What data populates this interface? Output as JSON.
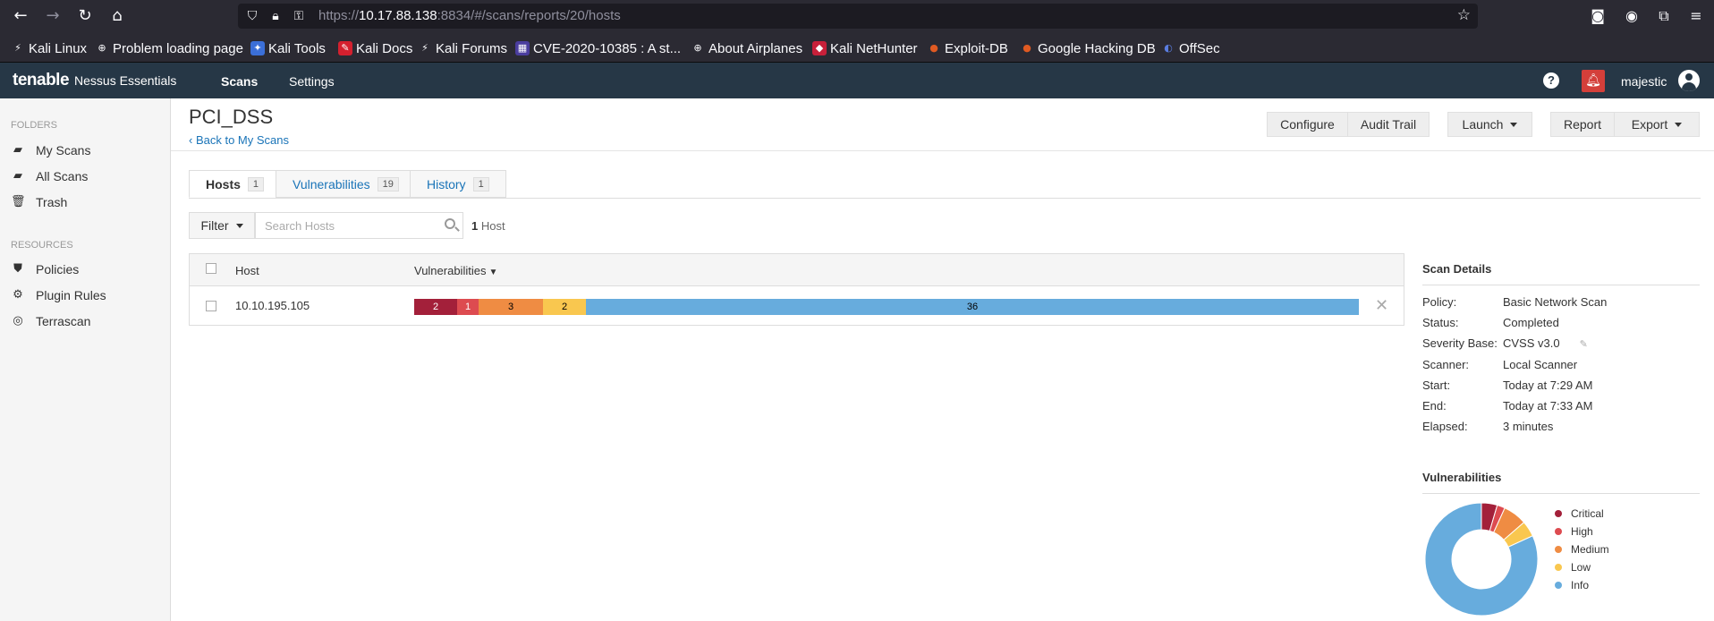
{
  "browser": {
    "url_prefix": "https://",
    "url_host": "10.17.88.138",
    "url_rest": ":8834/#/scans/reports/20/hosts",
    "bookmarks": [
      {
        "label": "Kali Linux",
        "icon": "kali-dragon-icon"
      },
      {
        "label": "Problem loading page",
        "icon": "globe-icon"
      },
      {
        "label": "Kali Tools",
        "icon": "kali-tools-icon"
      },
      {
        "label": "Kali Docs",
        "icon": "kali-docs-icon"
      },
      {
        "label": "Kali Forums",
        "icon": "kali-forums-icon"
      },
      {
        "label": "CVE-2020-10385 : A st...",
        "icon": "cve-icon"
      },
      {
        "label": "About Airplanes",
        "icon": "globe-icon"
      },
      {
        "label": "Kali NetHunter",
        "icon": "nethunter-icon"
      },
      {
        "label": "Exploit-DB",
        "icon": "exploit-db-icon"
      },
      {
        "label": "Google Hacking DB",
        "icon": "ghdb-icon"
      },
      {
        "label": "OffSec",
        "icon": "offsec-icon"
      }
    ]
  },
  "header": {
    "logo": "tenable",
    "product": "Nessus Essentials",
    "nav": [
      "Scans",
      "Settings"
    ],
    "username": "majestic",
    "help_glyph": "?"
  },
  "sidebar": {
    "folders_title": "FOLDERS",
    "folders": [
      {
        "label": "My Scans",
        "icon": "folder-icon"
      },
      {
        "label": "All Scans",
        "icon": "folder-icon"
      },
      {
        "label": "Trash",
        "icon": "trash-icon"
      }
    ],
    "resources_title": "RESOURCES",
    "resources": [
      {
        "label": "Policies",
        "icon": "shield-icon"
      },
      {
        "label": "Plugin Rules",
        "icon": "plugin-icon"
      },
      {
        "label": "Terrascan",
        "icon": "terrascan-icon"
      }
    ]
  },
  "page": {
    "title": "PCI_DSS",
    "back_link": "Back to My Scans",
    "buttons": {
      "configure": "Configure",
      "audit_trail": "Audit Trail",
      "launch": "Launch",
      "report": "Report",
      "export": "Export"
    },
    "tabs": [
      {
        "label": "Hosts",
        "count": "1"
      },
      {
        "label": "Vulnerabilities",
        "count": "19"
      },
      {
        "label": "History",
        "count": "1"
      }
    ],
    "filter_label": "Filter",
    "search_placeholder": "Search Hosts",
    "host_count_num": "1",
    "host_count_word": "Host"
  },
  "table": {
    "col_host": "Host",
    "col_vulns": "Vulnerabilities",
    "sort_glyph": "▼",
    "rows": [
      {
        "host": "10.10.195.105",
        "severities": [
          {
            "level": "Critical",
            "count": 2
          },
          {
            "level": "High",
            "count": 1
          },
          {
            "level": "Medium",
            "count": 3
          },
          {
            "level": "Low",
            "count": 2
          },
          {
            "level": "Info",
            "count": 36
          }
        ]
      }
    ]
  },
  "scan_details": {
    "title": "Scan Details",
    "rows": [
      {
        "label": "Policy:",
        "value": "Basic Network Scan"
      },
      {
        "label": "Status:",
        "value": "Completed"
      },
      {
        "label": "Severity Base:",
        "value": "CVSS v3.0"
      },
      {
        "label": "Scanner:",
        "value": "Local Scanner"
      },
      {
        "label": "Start:",
        "value": "Today at 7:29 AM"
      },
      {
        "label": "End:",
        "value": "Today at 7:33 AM"
      },
      {
        "label": "Elapsed:",
        "value": "3 minutes"
      }
    ]
  },
  "vuln_panel": {
    "title": "Vulnerabilities",
    "legend": [
      "Critical",
      "High",
      "Medium",
      "Low",
      "Info"
    ]
  },
  "colors": {
    "critical": "#a3203a",
    "high": "#dd4b50",
    "medium": "#ef8c43",
    "low": "#f9c74f",
    "info": "#67acdd",
    "header": "#263746",
    "link": "#1a74b8"
  },
  "chart_data": {
    "type": "pie",
    "categories": [
      "Critical",
      "High",
      "Medium",
      "Low",
      "Info"
    ],
    "values": [
      2,
      1,
      3,
      2,
      36
    ]
  }
}
